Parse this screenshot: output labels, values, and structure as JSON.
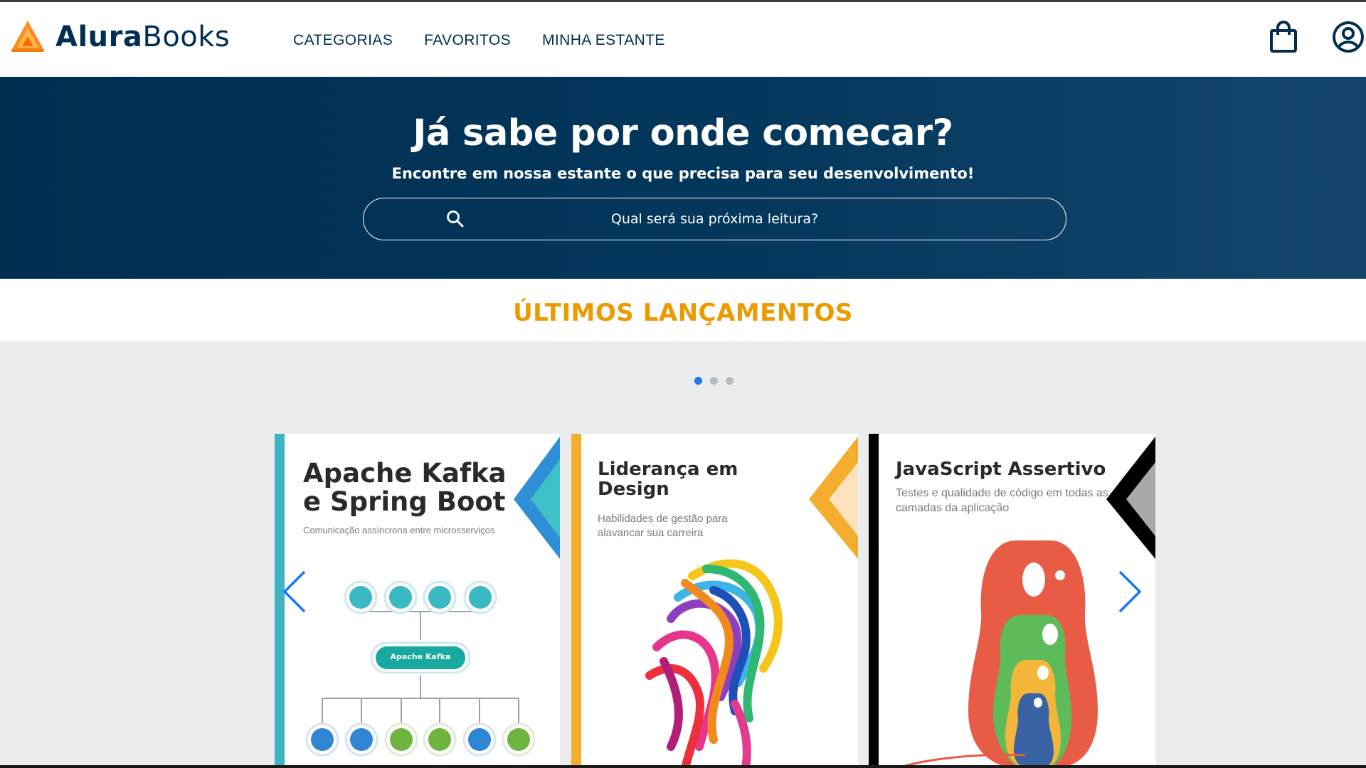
{
  "brand": {
    "name_bold": "Alura",
    "name_light": "Books"
  },
  "nav": {
    "items": [
      {
        "label": "CATEGORIAS"
      },
      {
        "label": "FAVORITOS"
      },
      {
        "label": "MINHA ESTANTE"
      }
    ]
  },
  "header_icons": {
    "bag": "shopping-bag-icon",
    "user": "user-account-icon"
  },
  "hero": {
    "title": "Já sabe por onde comecar?",
    "subtitle": "Encontre em nossa estante o que precisa para seu desenvolvimento!",
    "search_placeholder": "Qual será sua próxima leitura?"
  },
  "releases": {
    "title": "ÚLTIMOS LANÇAMENTOS",
    "active_page": 1,
    "page_count": 3,
    "books": [
      {
        "title": "Apache Kafka e Spring Boot",
        "subtitle": "Comunicação assíncrona entre microsserviços",
        "diagram_center_label": "Apache Kafka"
      },
      {
        "title": "Liderança em Design",
        "subtitle": "Habilidades de gestão para alavancar sua carreira"
      },
      {
        "title": "JavaScript Assertivo",
        "subtitle": "Testes e qualidade de código em todas as camadas da aplicação"
      }
    ]
  },
  "colors": {
    "brand_navy": "#002f52",
    "accent_orange": "#eb9b00",
    "carousel_blue": "#1877f2"
  }
}
